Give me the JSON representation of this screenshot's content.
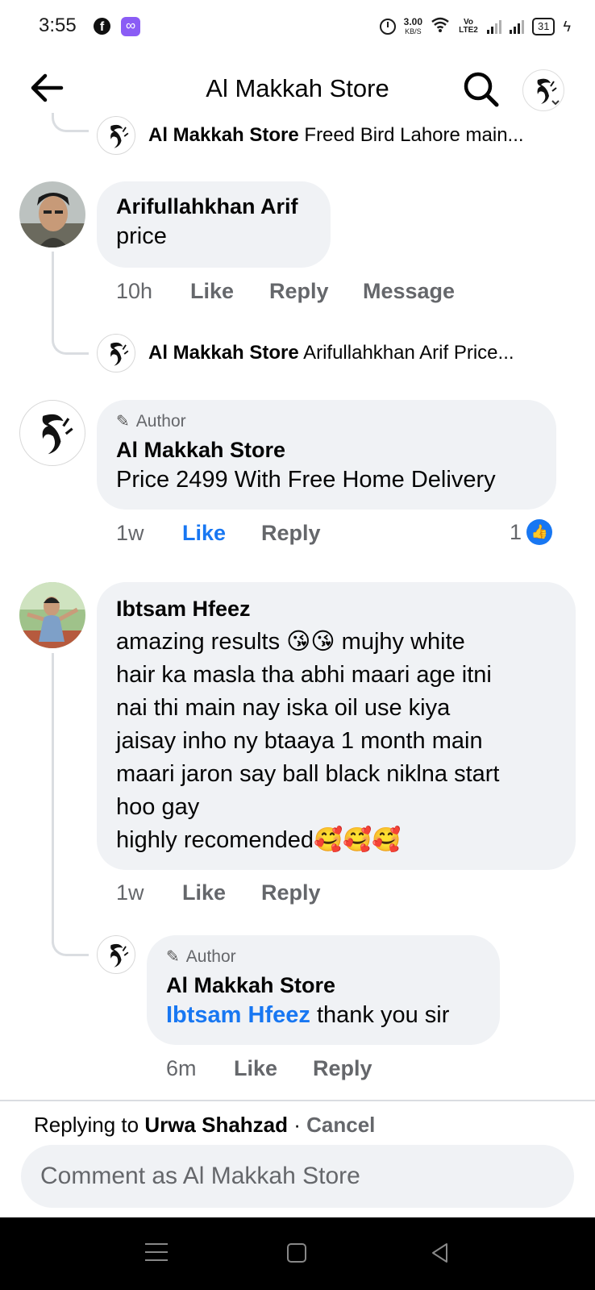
{
  "status_bar": {
    "time": "3:55",
    "speed_value": "3.00",
    "speed_unit": "KB/S",
    "volte": "Vo LTE2",
    "battery": "31"
  },
  "header": {
    "title": "Al Makkah Store",
    "back_icon": "arrow-left-icon",
    "search_icon": "search-icon"
  },
  "thread": {
    "top_reply": {
      "name": "Al Makkah Store",
      "preview": "Freed Bird Lahore main..."
    },
    "comments": [
      {
        "name": "Arifullahkhan Arif",
        "text": "price",
        "time": "10h",
        "actions": [
          "Like",
          "Reply",
          "Message"
        ],
        "reply_summary": {
          "name": "Al Makkah Store",
          "preview": "Arifullahkhan Arif Price..."
        }
      },
      {
        "author_tag": "Author",
        "name": "Al Makkah Store",
        "text": "Price 2499 With Free Home Delivery",
        "time": "1w",
        "actions": [
          "Like",
          "Reply"
        ],
        "reaction_count": "1"
      },
      {
        "name": "Ibtsam Hfeez",
        "text_lines": [
          "amazing results 😘😘 mujhy white",
          "hair ka masla tha abhi maari age itni",
          "nai thi main nay iska oil use kiya",
          "jaisay inho ny btaaya 1 month main",
          "maari jaron say ball black niklna start",
          "hoo gay",
          "highly recomended🥰🥰🥰"
        ],
        "time": "1w",
        "actions": [
          "Like",
          "Reply"
        ],
        "reply": {
          "author_tag": "Author",
          "name": "Al Makkah Store",
          "mention": "Ibtsam Hfeez",
          "text": " thank you sir",
          "time": "6m",
          "actions": [
            "Like",
            "Reply"
          ]
        }
      }
    ]
  },
  "composer": {
    "replying_prefix": "Replying to ",
    "replying_to": "Urwa Shahzad",
    "separator": " · ",
    "cancel": "Cancel",
    "placeholder": "Comment as Al Makkah Store"
  }
}
